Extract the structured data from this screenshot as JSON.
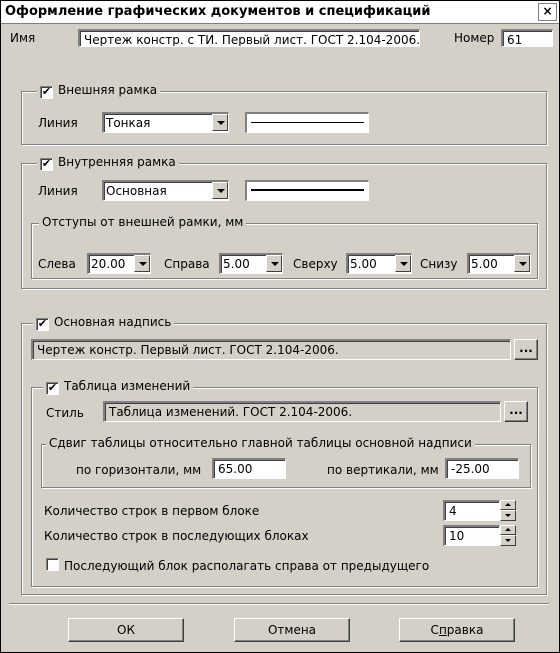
{
  "window": {
    "title": "Оформление графических документов и спецификаций",
    "close_label": "×"
  },
  "name_row": {
    "name_label": "Имя",
    "name_value": "Чертеж констр. с ТИ. Первый лист. ГОСТ 2.104-2006.",
    "number_label": "Номер",
    "number_value": "61"
  },
  "outer_frame": {
    "label": "Внешняя рамка",
    "checked": "✔",
    "line_label": "Линия",
    "line_value": "Тонкая"
  },
  "inner_frame": {
    "label": "Внутренняя рамка",
    "checked": "✔",
    "line_label": "Линия",
    "line_value": "Основная",
    "offsets": {
      "label": "Отступы от внешней рамки, мм",
      "left_label": "Слева",
      "left_value": "20.00",
      "right_label": "Справа",
      "right_value": "5.00",
      "top_label": "Сверху",
      "top_value": "5.00",
      "bottom_label": "Снизу",
      "bottom_value": "5.00"
    }
  },
  "title_block": {
    "label": "Основная надпись",
    "checked": "✔",
    "value": "Чертеж констр. Первый лист. ГОСТ 2.104-2006.",
    "browse_label": "...",
    "changes_table": {
      "label": "Таблица изменений",
      "checked": "✔",
      "style_label": "Стиль",
      "style_value": "Таблица изменений. ГОСТ 2.104-2006.",
      "browse_label": "...",
      "shift": {
        "label": "Сдвиг таблицы относительно главной таблицы основной надписи",
        "horizontal_label": "по горизонтали, мм",
        "horizontal_value": "65.00",
        "vertical_label": "по вертикали, мм",
        "vertical_value": "-25.00"
      },
      "rows_first_label": "Количество строк в первом блоке",
      "rows_first_value": "4",
      "rows_next_label": "Количество строк в последующих блоках",
      "rows_next_value": "10",
      "place_right_label": "Последующий блок располагать справа от предыдущего"
    }
  },
  "buttons": {
    "ok": "ОК",
    "cancel": "Отмена",
    "help_prefix": "С",
    "help_underlined": "п",
    "help_suffix": "равка"
  }
}
